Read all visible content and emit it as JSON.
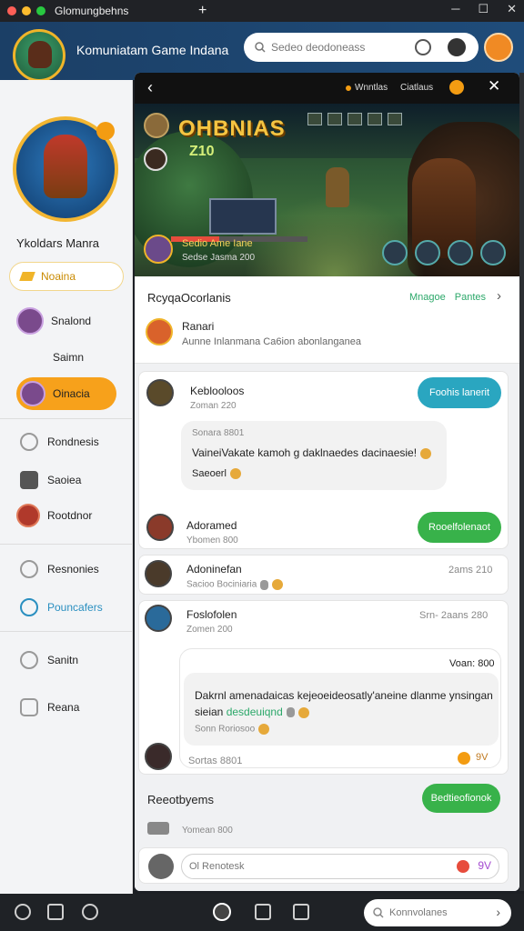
{
  "window": {
    "tab_title": "Glomungbehns",
    "new_tab": "+"
  },
  "header": {
    "app_title": "Komuniatam Game Indana",
    "search_placeholder": "Sedeo deodoneass"
  },
  "sidebar": {
    "profile_name": "Ykoldars Manra",
    "follow_label": "Noaina",
    "items": [
      {
        "label": "Snalond"
      },
      {
        "label": "Saimn"
      },
      {
        "label": "Oinacia"
      },
      {
        "label": "Rondnesis"
      },
      {
        "label": "Saoiea"
      },
      {
        "label": "Rootdnor"
      },
      {
        "label": "Resnonies"
      },
      {
        "label": "Pouncafers"
      },
      {
        "label": "Sanitn"
      },
      {
        "label": "Reana"
      }
    ]
  },
  "panel": {
    "top_labels": [
      "Wnntlas",
      "Ciatlaus"
    ],
    "game": {
      "title": "OHBNIAS",
      "subtitle": "Z10",
      "player_name": "Sedio Ame Iane",
      "player_stats": "Sedse Jasma 200",
      "hp_fraction": 0.35
    },
    "info": {
      "title": "RcyqaOcorlanis",
      "links": [
        "Mnagoe",
        "Pantes"
      ],
      "game_name": "Ranari",
      "game_desc": "Aunne Inlanmana Ca6ion abonlanganea"
    }
  },
  "feed": {
    "posts": [
      {
        "name": "Keblooloos",
        "time": "Zoman 220",
        "button": "Foohis lanerit"
      },
      {
        "name": "Adoramed",
        "time": "Ybomen 800",
        "button": "Rooelfolenaot"
      },
      {
        "name": "Adoninefan",
        "time": "Sacioo Bociniaria",
        "right": "2ams 210"
      },
      {
        "name": "Foslofolen",
        "time": "Zomen 200",
        "right": "Srn- 2aans 280"
      }
    ],
    "bubble1": {
      "meta": "Sonara 8801",
      "text": "VaineiVakate kamoh g daklnaedes dacinaesie!",
      "reaction": "Saeoerl"
    },
    "bubble2": {
      "header_right": "Voan: 800",
      "text1": "Dakrnl amenadaicas kejeoeideosatly'aneine dlanme ynsingan",
      "text2_lead": "sieian",
      "text2_green": "desdeuiqnd",
      "meta": "Sonn Roriosoo",
      "footer": "Sortas 8801"
    },
    "recent_label": "Reeotbyems",
    "recent_button": "Bedtieofionok",
    "recent_meta": "Yomean 800",
    "composer_placeholder": "Ol Renotesk",
    "composer_right": "9V"
  },
  "dock": {
    "search_placeholder": "Konnvolanes"
  }
}
